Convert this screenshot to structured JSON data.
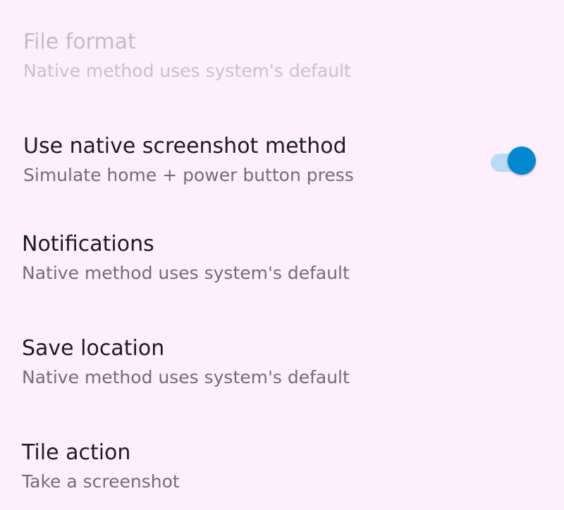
{
  "preferences": [
    {
      "title": "File format",
      "summary": "Native method uses system's default",
      "enabled": false
    },
    {
      "title": "Use native screenshot method",
      "summary": "Simulate home + power button press",
      "enabled": true,
      "switch_on": true
    },
    {
      "title": "Notifications",
      "summary": "Native method uses system's default",
      "enabled": true
    },
    {
      "title": "Save location",
      "summary": "Native method uses system's default",
      "enabled": true
    },
    {
      "title": "Tile action",
      "summary": "Take a screenshot",
      "enabled": true
    }
  ],
  "colors": {
    "background": "#fdf0fc",
    "switch_thumb": "#0288d1",
    "switch_track": "#b9dcf3",
    "title_text": "#1d1b20",
    "summary_text": "#726c78",
    "disabled_text": "#c3bcc8"
  }
}
